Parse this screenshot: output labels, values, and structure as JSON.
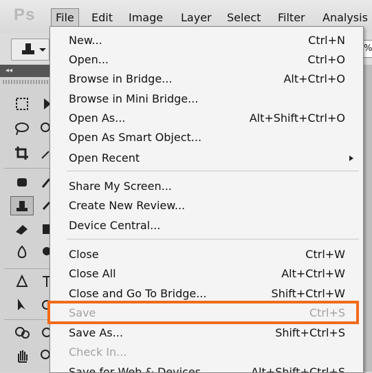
{
  "app": {
    "logo": "Ps"
  },
  "menubar": {
    "items": [
      "File",
      "Edit",
      "Image",
      "Layer",
      "Select",
      "Filter",
      "Analysis"
    ],
    "active": "File"
  },
  "options_bar": {
    "field_value": "%"
  },
  "tools_panel": {
    "collapse_glyph": "◂◂"
  },
  "file_menu": {
    "items": [
      {
        "label": "New...",
        "shortcut": "Ctrl+N",
        "enabled": true
      },
      {
        "label": "Open...",
        "shortcut": "Ctrl+O",
        "enabled": true
      },
      {
        "label": "Browse in Bridge...",
        "shortcut": "Alt+Ctrl+O",
        "enabled": true
      },
      {
        "label": "Browse in Mini Bridge...",
        "shortcut": "",
        "enabled": true
      },
      {
        "label": "Open As...",
        "shortcut": "Alt+Shift+Ctrl+O",
        "enabled": true
      },
      {
        "label": "Open As Smart Object...",
        "shortcut": "",
        "enabled": true
      },
      {
        "label": "Open Recent",
        "shortcut": "",
        "enabled": true,
        "submenu": true
      },
      {
        "label": "Share My Screen...",
        "shortcut": "",
        "enabled": true
      },
      {
        "label": "Create New Review...",
        "shortcut": "",
        "enabled": true
      },
      {
        "label": "Device Central...",
        "shortcut": "",
        "enabled": true
      },
      {
        "label": "Close",
        "shortcut": "Ctrl+W",
        "enabled": true
      },
      {
        "label": "Close All",
        "shortcut": "Alt+Ctrl+W",
        "enabled": true
      },
      {
        "label": "Close and Go To Bridge...",
        "shortcut": "Shift+Ctrl+W",
        "enabled": true
      },
      {
        "label": "Save",
        "shortcut": "Ctrl+S",
        "enabled": false,
        "highlighted": true
      },
      {
        "label": "Save As...",
        "shortcut": "Shift+Ctrl+S",
        "enabled": true
      },
      {
        "label": "Check In...",
        "shortcut": "",
        "enabled": false
      },
      {
        "label": "Save for Web & Devices...",
        "shortcut": "Alt+Shift+Ctrl+S",
        "enabled": true
      }
    ]
  },
  "colors": {
    "highlight": "#f26a1b",
    "disabled_text": "#a2a2a2"
  }
}
